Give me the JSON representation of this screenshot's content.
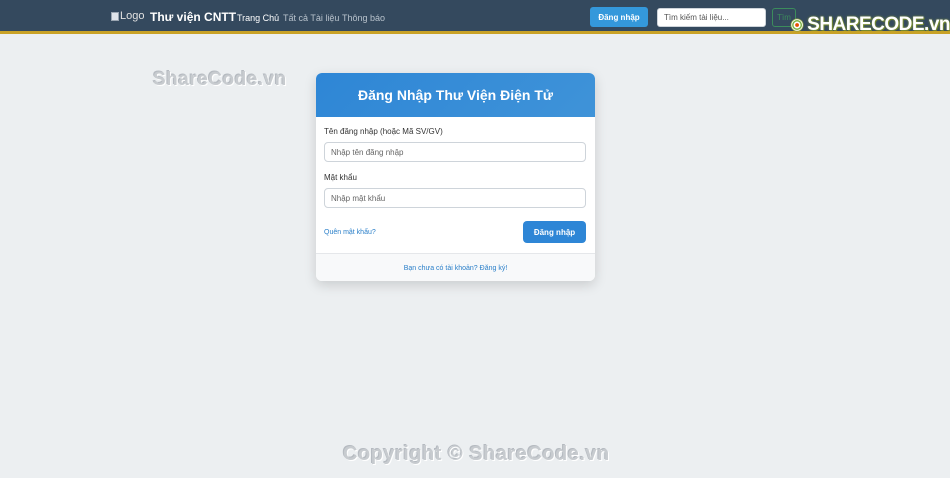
{
  "navbar": {
    "logo_alt": "Logo",
    "brand": "Thư viện CNTT",
    "links": [
      "Trang Chủ",
      "Tất cả Tài liệu",
      "Thông báo"
    ],
    "login_button": "Đăng nhập",
    "search_placeholder": "Tìm kiếm tài liệu...",
    "search_button": "Tìm"
  },
  "watermarks": {
    "top": "ShareCode.vn",
    "bottom": "Copyright © ShareCode.vn",
    "logo": "SHARECODE.vn"
  },
  "login_card": {
    "title": "Đăng Nhập Thư Viện Điện Tử",
    "username_label": "Tên đăng nhập (hoặc Mã SV/GV)",
    "username_placeholder": "Nhập tên đăng nhập",
    "password_label": "Mật khẩu",
    "password_placeholder": "Nhập mật khẩu",
    "forgot_password": "Quên mật khẩu?",
    "submit": "Đăng nhập",
    "register": "Bạn chưa có tài khoản? Đăng ký!"
  },
  "colors": {
    "navbar_bg": "#34495e",
    "accent": "#2e86d6",
    "page_bg": "#eceff1"
  }
}
